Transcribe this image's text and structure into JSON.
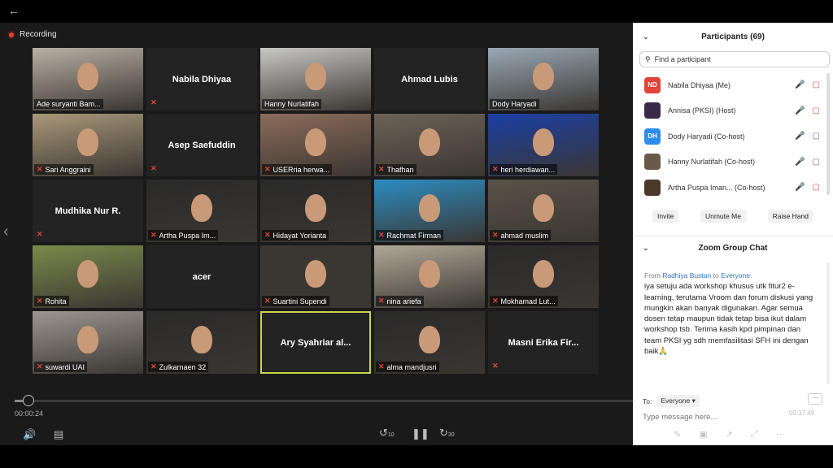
{
  "stage": {
    "recording_label": "Recording",
    "timestamp": "00:00:24",
    "progress_fraction": 0.02,
    "tiles": [
      {
        "name": "Ade suryanti Bam...",
        "video": true,
        "bg": "#b9b0a4",
        "muted": false
      },
      {
        "bigname": "Nabila Dhiyaa",
        "video": false,
        "muted": true
      },
      {
        "name": "Hanny Nurlatifah",
        "video": true,
        "bg": "#c8c8c4",
        "muted": false
      },
      {
        "bigname": "Ahmad Lubis",
        "video": false,
        "muted": false
      },
      {
        "name": "Dody Haryadi",
        "video": true,
        "bg": "#9aa8b4",
        "muted": false
      },
      {
        "name": "Sari Anggraini",
        "video": true,
        "bg": "#a9987a",
        "muted": true
      },
      {
        "bigname": "Asep Saefuddin",
        "video": false,
        "muted": true
      },
      {
        "name": "USERria herwa...",
        "video": true,
        "bg": "#8c6c5a",
        "muted": true
      },
      {
        "name": "Thafhan",
        "video": true,
        "bg": "#6c6256",
        "muted": true
      },
      {
        "name": "heri herdiawan...",
        "video": true,
        "bg": "#1b3fa3",
        "muted": true
      },
      {
        "bigname": "Mudhika Nur R.",
        "video": false,
        "muted": true
      },
      {
        "name": "Artha Puspa Im...",
        "video": true,
        "bg": "#2a2a2a",
        "muted": true
      },
      {
        "name": "Hidayat Yorianta",
        "video": true,
        "bg": "#2a2a2a",
        "muted": true
      },
      {
        "name": "Rachmat Firman",
        "video": true,
        "bg": "#2c8cc0",
        "muted": true
      },
      {
        "name": "ahmad muslim",
        "video": true,
        "bg": "#5a5248",
        "muted": true
      },
      {
        "name": "Rohita",
        "video": true,
        "bg": "#7a8a4a",
        "muted": true
      },
      {
        "bigname": "acer",
        "video": false,
        "muted": false
      },
      {
        "name": "Suartini Supendi",
        "video": true,
        "bg": "#3a3632",
        "muted": true
      },
      {
        "name": "nina ariefa",
        "video": true,
        "bg": "#b0a898",
        "muted": true
      },
      {
        "name": "Mokhamad Lut...",
        "video": true,
        "bg": "#2a2a2a",
        "muted": true
      },
      {
        "name": "suwardi UAI",
        "video": true,
        "bg": "#9c9690",
        "muted": true
      },
      {
        "name": "Zulkarnaen 32",
        "video": true,
        "bg": "#2a2a2a",
        "muted": true
      },
      {
        "bigname": "Ary Syahriar al...",
        "video": false,
        "muted": false,
        "active": true
      },
      {
        "name": "alma mandjusri",
        "video": true,
        "bg": "#2a2a2a",
        "muted": true
      },
      {
        "bigname": "Masni Erika Fir...",
        "video": false,
        "muted": true
      }
    ]
  },
  "panel": {
    "participants_title": "Participants (69)",
    "search_placeholder": "Find a participant",
    "participants": [
      {
        "name": "Nabila Dhiyaa (Me)",
        "initials": "ND",
        "avatar_color": "#e0443a"
      },
      {
        "name": "Annisa (PKSI) (Host)",
        "initials": "",
        "avatar_color": "#3a2a4a"
      },
      {
        "name": "Dody Haryadi (Co-host)",
        "initials": "DH",
        "avatar_color": "#2d8cf0"
      },
      {
        "name": "Hanny Nurlatifah (Co-host)",
        "initials": "",
        "avatar_color": "#6a5a4a"
      },
      {
        "name": "Artha Puspa Iman... (Co-host)",
        "initials": "",
        "avatar_color": "#4a3a2a"
      }
    ],
    "invite_label": "Invite",
    "unmute_label": "Unmute Me",
    "raise_hand_label": "Raise Hand",
    "chat_title": "Zoom Group Chat",
    "chat_from_label": "From",
    "chat_sender": "Radhiya Bustan",
    "chat_to_label": "to",
    "chat_recipient": "Everyone:",
    "chat_message": "iya setuju ada workshop khusus utk fitur2 e-learning, terutama Vroom dan forum diskusi yang mungkin akan banyak digunakan. Agar semua dosen tetap maupun tidak tetap bisa ikut dalam workshop tsb. Terima kasih kpd pimpinan dan team PKSI yg sdh memfasilitasi SFH ini dengan baik🙏",
    "to_label": "To:",
    "to_value": "Everyone",
    "message_placeholder": "Type message here...",
    "panel_timestamp": "00:37:49"
  },
  "icons": {
    "back": "back-arrow-icon",
    "recording": "recording-dot-icon",
    "volume": "volume-icon",
    "captions": "captions-icon",
    "rewind": "rewind-10-icon",
    "pause": "pause-icon",
    "forward": "forward-30-icon"
  }
}
